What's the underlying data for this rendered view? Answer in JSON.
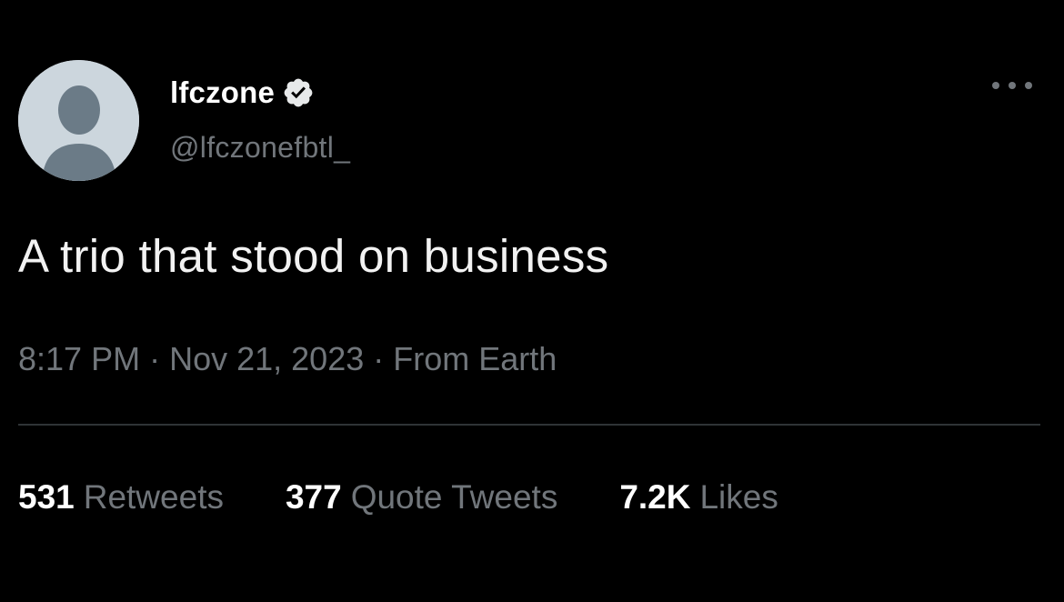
{
  "tweet": {
    "display_name": "lfczone",
    "handle": "@lfczonefbtl_",
    "text": "A trio that stood on business",
    "time": "8:17 PM",
    "date": "Nov 21, 2023",
    "source": "From Earth",
    "separator": "·",
    "verified": true
  },
  "stats": {
    "retweets_count": "531",
    "retweets_label": "Retweets",
    "quotes_count": "377",
    "quotes_label": "Quote Tweets",
    "likes_count": "7.2K",
    "likes_label": "Likes"
  },
  "icons": {
    "avatar": "default-avatar-icon",
    "verified": "verified-badge-icon",
    "more": "more-options-icon"
  },
  "colors": {
    "background": "#000000",
    "primary_text": "#ffffff",
    "secondary_text": "#71767b",
    "divider": "#2f3336",
    "avatar_bg": "#ccd6dd",
    "avatar_figure": "#6b7b87"
  }
}
